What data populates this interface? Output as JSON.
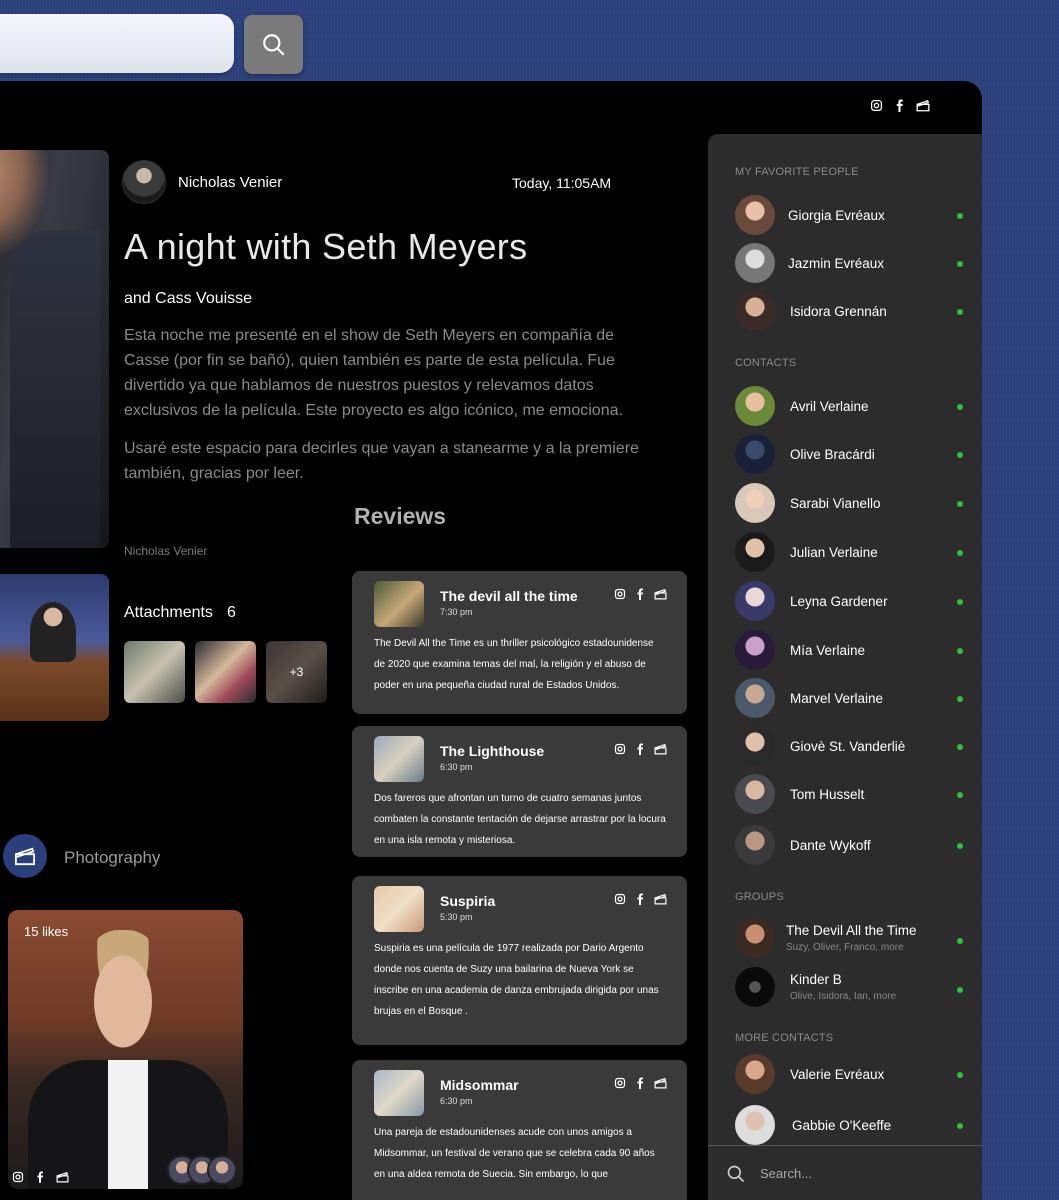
{
  "header": {
    "search_value": "",
    "social_icons": [
      "instagram-icon",
      "facebook-icon",
      "clapperboard-icon"
    ]
  },
  "post": {
    "author": "Nicholas Venier",
    "time": "Today, 11:05AM",
    "title": "A night with Seth Meyers",
    "subtitle": "and Cass Vouisse",
    "paragraph1": "Esta noche me presenté en el show de Seth Meyers en compañía de Casse (por fin se bañó), quien también es parte de esta película. Fue divertido ya que hablamos de nuestros puestos y relevamos datos exclusivos de la película. Este proyecto es algo icónico, me emociona.",
    "paragraph2": "Usaré este espacio para decirles que vayan a stanearme y a la premiere también, gracias por leer.",
    "byline": "Nicholas Venier",
    "attachments_label": "Attachments",
    "attachments_count": "6",
    "more_count": "+3"
  },
  "photography": {
    "label": "Photography",
    "likes": "15 likes"
  },
  "reviews": {
    "title": "Reviews",
    "items": [
      {
        "title": "The devil all the time",
        "time": "7:30 pm",
        "text": "The Devil All the Time es un thriller psicológico estadounidense de 2020 que examina temas del mal, la religión y el abuso de poder en una pequeña ciudad rural de Estados Unidos."
      },
      {
        "title": "The Lighthouse",
        "time": "6:30 pm",
        "text": "Dos fareros que afrontan un turno de cuatro semanas juntos combaten la constante tentación de dejarse arrastrar por la locura en una isla remota y misteriosa."
      },
      {
        "title": "Suspiria",
        "time": "5:30 pm",
        "text": "Suspiria es una película de 1977 realizada por Dario Argento donde nos cuenta de Suzy una bailarina de Nueva York se inscribe en una academia de danza embrujada dirigida por unas brujas en el Bosque ."
      },
      {
        "title": "Midsommar",
        "time": "6:30 pm",
        "text": "Una pareja de estadounidenses acude con unos amigos a Midsommar, un festival de verano que se celebra cada 90 años en una aldea remota de Suecia. Sin embargo, lo que"
      }
    ]
  },
  "sidebar": {
    "favorites_label": "MY FAVORITE PEOPLE",
    "favorites": [
      "Giorgia Evréaux",
      "Jazmin Evréaux",
      "Isidora Grennán"
    ],
    "contacts_label": "CONTACTS",
    "contacts": [
      "Avril Verlaine",
      "Olive Bracárdi",
      "Sarabi Vianello",
      "Julian Verlaine",
      "Leyna Gardener",
      "Mía Verlaine",
      "Marvel Verlaine",
      "Giovè St. Vanderliè",
      "Tom Husselt",
      "Dante Wykoff"
    ],
    "groups_label": "GROUPS",
    "groups": [
      {
        "name": "The Devil All the Time",
        "members": "Suzy, Oliver, Franco, more"
      },
      {
        "name": "Kinder B",
        "members": "Olive, Isidora, Ian, more"
      }
    ],
    "more_label": "MORE CONTACTS",
    "more_contacts": [
      "Valerie Evréaux",
      "Gabbie O'Keeffe"
    ],
    "search_placeholder": "Search...",
    "online_color": "#2fbf3a"
  }
}
